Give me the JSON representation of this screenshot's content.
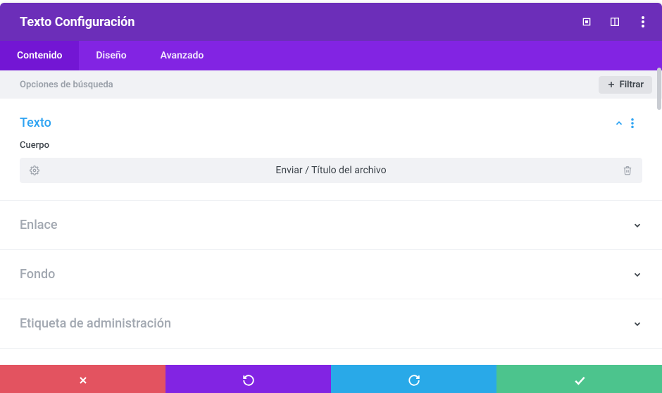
{
  "header": {
    "title": "Texto Configuración"
  },
  "tabs": [
    {
      "label": "Contenido",
      "active": true
    },
    {
      "label": "Diseño",
      "active": false
    },
    {
      "label": "Avanzado",
      "active": false
    }
  ],
  "filter_bar": {
    "placeholder": "Opciones de búsqueda",
    "filter_button": "Filtrar"
  },
  "sections": {
    "texto": {
      "title": "Texto",
      "expanded": true,
      "field_label": "Cuerpo",
      "field_value": "Enviar / Título del archivo"
    },
    "enlace": {
      "title": "Enlace"
    },
    "fondo": {
      "title": "Fondo"
    },
    "etiqueta": {
      "title": "Etiqueta de administración"
    }
  }
}
